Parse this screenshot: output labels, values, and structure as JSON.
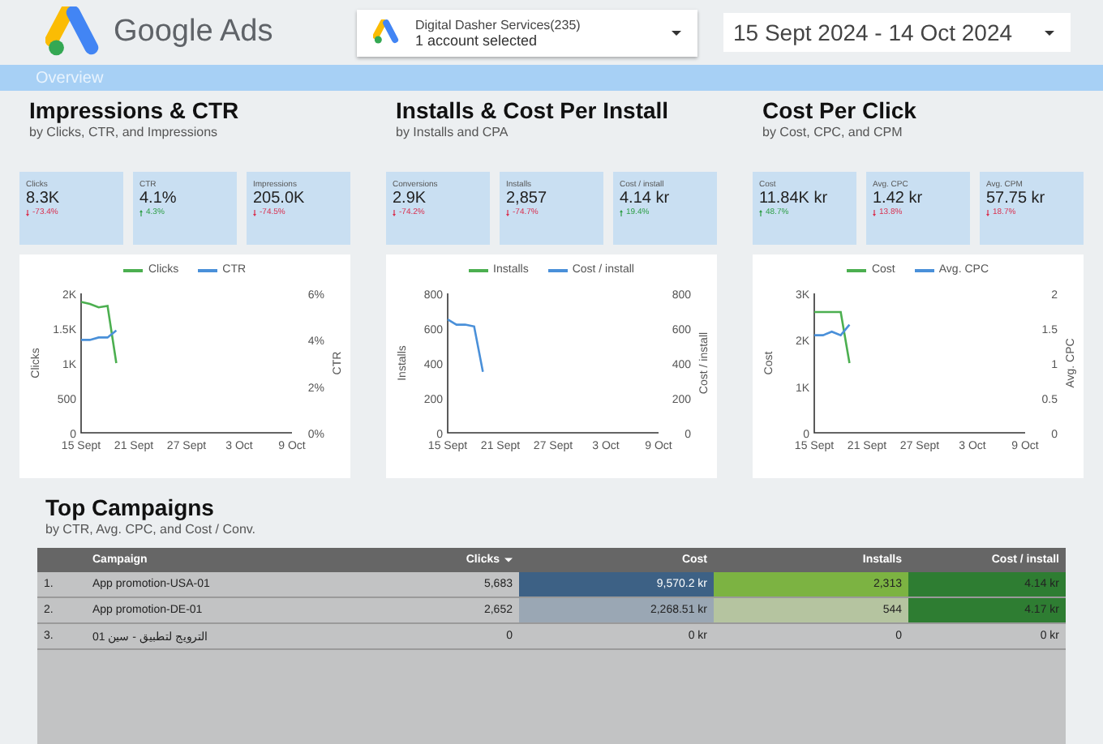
{
  "header": {
    "logo_text": "Google Ads",
    "account": {
      "name": "Digital Dasher Services(235)",
      "detail": "1 account selected"
    },
    "date_range": "15 Sept 2024 - 14 Oct 2024"
  },
  "band": {
    "label": "Overview"
  },
  "sections": [
    {
      "title": "Impressions & CTR",
      "subtitle": "by Clicks, CTR, and Impressions",
      "kpis": [
        {
          "label": "Clicks",
          "value": "8.3K",
          "delta": "-73.4%",
          "increase": false
        },
        {
          "label": "CTR",
          "value": "4.1%",
          "delta": "4.3%",
          "increase": true
        },
        {
          "label": "Impressions",
          "value": "205.0K",
          "delta": "-74.5%",
          "increase": false
        }
      ],
      "chart_data": {
        "type": "line",
        "legend": "top",
        "ylabel": "Clicks",
        "y2label": "CTR",
        "categories": [
          "15 Sept",
          null,
          null,
          null,
          null,
          null,
          "21 Sept",
          null,
          null,
          null,
          null,
          null,
          "27 Sept",
          null,
          null,
          null,
          null,
          null,
          "3 Oct",
          null,
          null,
          null,
          null,
          null,
          "9 Oct"
        ],
        "ylim": [
          0,
          2000
        ],
        "yticks": [
          {
            "value": 0,
            "label": "0"
          },
          {
            "value": 500,
            "label": "500"
          },
          {
            "value": 1000,
            "label": "1K"
          },
          {
            "value": 1500,
            "label": "1.5K"
          },
          {
            "value": 2000,
            "label": "2K"
          }
        ],
        "y2lim": [
          0,
          6
        ],
        "y2ticks": [
          {
            "value": 0,
            "label": "0%"
          },
          {
            "value": 2,
            "label": "2%"
          },
          {
            "value": 4,
            "label": "4%"
          },
          {
            "value": 6,
            "label": "6%"
          }
        ],
        "series": [
          {
            "name": "Clicks",
            "color": "#4caf50",
            "values": [
              1880,
              1850,
              1800,
              1820,
              1000,
              null,
              null,
              null,
              null,
              null,
              null,
              null,
              null,
              null,
              null,
              null,
              null,
              null,
              null,
              null,
              null,
              null,
              null,
              null,
              null
            ]
          },
          {
            "name": "CTR",
            "color": "#4a90d9",
            "axis": "y2",
            "values": [
              4,
              4,
              4.1,
              4.1,
              4.4,
              null,
              null,
              null,
              null,
              null,
              null,
              null,
              null,
              null,
              null,
              null,
              null,
              null,
              null,
              null,
              null,
              null,
              null,
              null,
              null
            ]
          }
        ]
      }
    },
    {
      "title": "Installs & Cost Per Install",
      "subtitle": "by Installs and CPA",
      "kpis": [
        {
          "label": "Conversions",
          "value": "2.9K",
          "delta": "-74.2%",
          "increase": false
        },
        {
          "label": "Installs",
          "value": "2,857",
          "delta": "-74.7%",
          "increase": false
        },
        {
          "label": "Cost / install",
          "value": "4.14 kr",
          "delta": "19.4%",
          "increase": true
        }
      ],
      "chart_data": {
        "type": "line",
        "legend": "top",
        "ylabel": "Installs",
        "y2label": "Cost / install",
        "categories": [
          "15 Sept",
          null,
          null,
          null,
          null,
          null,
          "21 Sept",
          null,
          null,
          null,
          null,
          null,
          "27 Sept",
          null,
          null,
          null,
          null,
          null,
          "3 Oct",
          null,
          null,
          null,
          null,
          null,
          "9 Oct"
        ],
        "ylim": [
          0,
          800
        ],
        "yticks": [
          {
            "value": 0,
            "label": "0"
          },
          {
            "value": 200,
            "label": "200"
          },
          {
            "value": 400,
            "label": "400"
          },
          {
            "value": 600,
            "label": "600"
          },
          {
            "value": 800,
            "label": "800"
          }
        ],
        "y2lim": [
          0,
          800
        ],
        "y2ticks": [
          {
            "value": 0,
            "label": "0"
          },
          {
            "value": 200,
            "label": "200"
          },
          {
            "value": 400,
            "label": "400"
          },
          {
            "value": 600,
            "label": "600"
          },
          {
            "value": 800,
            "label": "800"
          }
        ],
        "series": [
          {
            "name": "Installs",
            "color": "#4caf50",
            "values": [
              null,
              null,
              null,
              null,
              null,
              null,
              null,
              null,
              null,
              null,
              null,
              null,
              null,
              null,
              null,
              null,
              null,
              null,
              null,
              null,
              null,
              null,
              null,
              null,
              null
            ]
          },
          {
            "name": "Cost / install",
            "color": "#4a90d9",
            "axis": "y2",
            "values": [
              650,
              620,
              620,
              610,
              350,
              null,
              null,
              null,
              null,
              null,
              null,
              null,
              null,
              null,
              null,
              null,
              null,
              null,
              null,
              null,
              null,
              null,
              null,
              null,
              null
            ]
          }
        ]
      }
    },
    {
      "title": "Cost Per Click",
      "subtitle": "by Cost, CPC, and CPM",
      "kpis": [
        {
          "label": "Cost",
          "value": "11.84K kr",
          "delta": "48.7%",
          "increase": true
        },
        {
          "label": "Avg. CPC",
          "value": "1.42 kr",
          "delta": "13.8%",
          "increase": false
        },
        {
          "label": "Avg. CPM",
          "value": "57.75 kr",
          "delta": "18.7%",
          "increase": false
        }
      ],
      "chart_data": {
        "type": "line",
        "legend": "top",
        "ylabel": "Cost",
        "y2label": "Avg. CPC",
        "categories": [
          "15 Sept",
          null,
          null,
          null,
          null,
          null,
          "21 Sept",
          null,
          null,
          null,
          null,
          null,
          "27 Sept",
          null,
          null,
          null,
          null,
          null,
          "3 Oct",
          null,
          null,
          null,
          null,
          null,
          "9 Oct"
        ],
        "ylim": [
          0,
          3000
        ],
        "yticks": [
          {
            "value": 0,
            "label": "0"
          },
          {
            "value": 1000,
            "label": "1K"
          },
          {
            "value": 2000,
            "label": "2K"
          },
          {
            "value": 3000,
            "label": "3K"
          }
        ],
        "y2lim": [
          0,
          2
        ],
        "y2ticks": [
          {
            "value": 0,
            "label": "0"
          },
          {
            "value": 0.5,
            "label": "0.5"
          },
          {
            "value": 1,
            "label": "1"
          },
          {
            "value": 1.5,
            "label": "1.5"
          },
          {
            "value": 2,
            "label": "2"
          }
        ],
        "series": [
          {
            "name": "Cost",
            "color": "#4caf50",
            "values": [
              2600,
              2600,
              2600,
              2600,
              1500,
              null,
              null,
              null,
              null,
              null,
              null,
              null,
              null,
              null,
              null,
              null,
              null,
              null,
              null,
              null,
              null,
              null,
              null,
              null,
              null
            ]
          },
          {
            "name": "Avg. CPC",
            "color": "#4a90d9",
            "axis": "y2",
            "values": [
              1.4,
              1.4,
              1.45,
              1.4,
              1.55,
              null,
              null,
              null,
              null,
              null,
              null,
              null,
              null,
              null,
              null,
              null,
              null,
              null,
              null,
              null,
              null,
              null,
              null,
              null,
              null
            ]
          }
        ]
      }
    }
  ],
  "campaigns": {
    "title": "Top Campaigns",
    "subtitle": "by CTR, Avg. CPC, and Cost / Conv.",
    "columns": [
      {
        "sorted": false
      },
      {
        "label": "Campaign",
        "sorted": false
      },
      {
        "label": "Clicks",
        "sorted": true
      },
      {
        "label": "Cost",
        "sorted": false
      },
      {
        "label": "Installs",
        "sorted": false
      },
      {
        "label": "Cost / install",
        "sorted": false
      }
    ],
    "rows": [
      [
        {
          "text": "1."
        },
        {
          "text": "App promotion-USA-01"
        },
        {
          "text": "5,683"
        },
        {
          "text": "9,570.2 kr",
          "color": "#3d6185"
        },
        {
          "text": "2,313",
          "color": "#7cb342"
        },
        {
          "text": "4.14 kr",
          "color": "#2e7d32"
        }
      ],
      [
        {
          "text": "2."
        },
        {
          "text": "App promotion-DE-01"
        },
        {
          "text": "2,652"
        },
        {
          "text": "2,268.51 kr",
          "color": "#9aa7b4"
        },
        {
          "text": "544",
          "color": "#b5c4a0"
        },
        {
          "text": "4.17 kr",
          "color": "#2e7d32"
        }
      ],
      [
        {
          "text": "3."
        },
        {
          "text": "الترويج لتطبيق - سين 01"
        },
        {
          "text": "0"
        },
        {
          "text": "0 kr"
        },
        {
          "text": "0"
        },
        {
          "text": "0 kr"
        }
      ]
    ]
  }
}
